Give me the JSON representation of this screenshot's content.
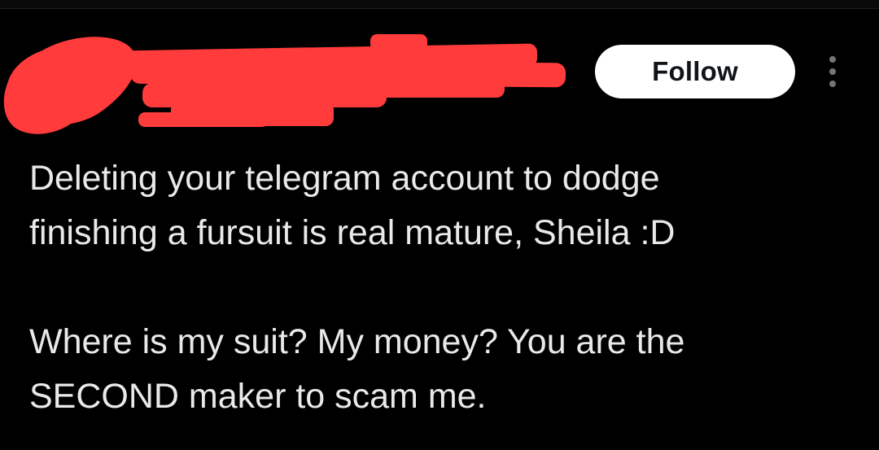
{
  "tweet": {
    "follow_label": "Follow",
    "more_icon": "more-vertical-icon",
    "paragraphs": [
      {
        "lines": [
          "Deleting your telegram account to dodge",
          "finishing a fursuit is real mature, Sheila :D"
        ]
      },
      {
        "lines": [
          "Where is my suit? My money? You are the",
          "SECOND maker to scam me."
        ]
      }
    ]
  },
  "colors": {
    "background": "#000000",
    "text": "#e7e9ea",
    "follow_bg": "#ffffff",
    "follow_text": "#0f1419",
    "muted_icon": "#71767b",
    "redaction": "#ff3b3b"
  }
}
